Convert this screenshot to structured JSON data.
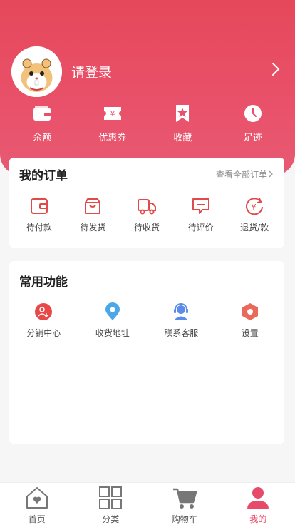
{
  "profile": {
    "login_label": "请登录"
  },
  "stats": [
    {
      "label": "余额",
      "icon": "wallet-icon"
    },
    {
      "label": "优惠券",
      "icon": "coupon-icon"
    },
    {
      "label": "收藏",
      "icon": "bookmark-star-icon"
    },
    {
      "label": "足迹",
      "icon": "clock-icon"
    }
  ],
  "orders": {
    "title": "我的订单",
    "view_all": "查看全部订单",
    "items": [
      {
        "label": "待付款",
        "icon": "wallet-outline-icon"
      },
      {
        "label": "待发货",
        "icon": "box-icon"
      },
      {
        "label": "待收货",
        "icon": "truck-icon"
      },
      {
        "label": "待评价",
        "icon": "comment-icon"
      },
      {
        "label": "退货/款",
        "icon": "refund-icon"
      }
    ]
  },
  "functions": {
    "title": "常用功能",
    "items": [
      {
        "label": "分销中心",
        "icon": "distribution-icon"
      },
      {
        "label": "收货地址",
        "icon": "location-icon"
      },
      {
        "label": "联系客服",
        "icon": "customer-service-icon"
      },
      {
        "label": "设置",
        "icon": "settings-icon"
      }
    ]
  },
  "tabbar": {
    "items": [
      {
        "label": "首页",
        "icon": "home-icon"
      },
      {
        "label": "分类",
        "icon": "category-grid-icon"
      },
      {
        "label": "购物车",
        "icon": "cart-icon"
      },
      {
        "label": "我的",
        "icon": "user-icon"
      }
    ],
    "active": "我的"
  },
  "colors": {
    "brand": "#e84a6a",
    "accent_red": "#e24a4a"
  }
}
